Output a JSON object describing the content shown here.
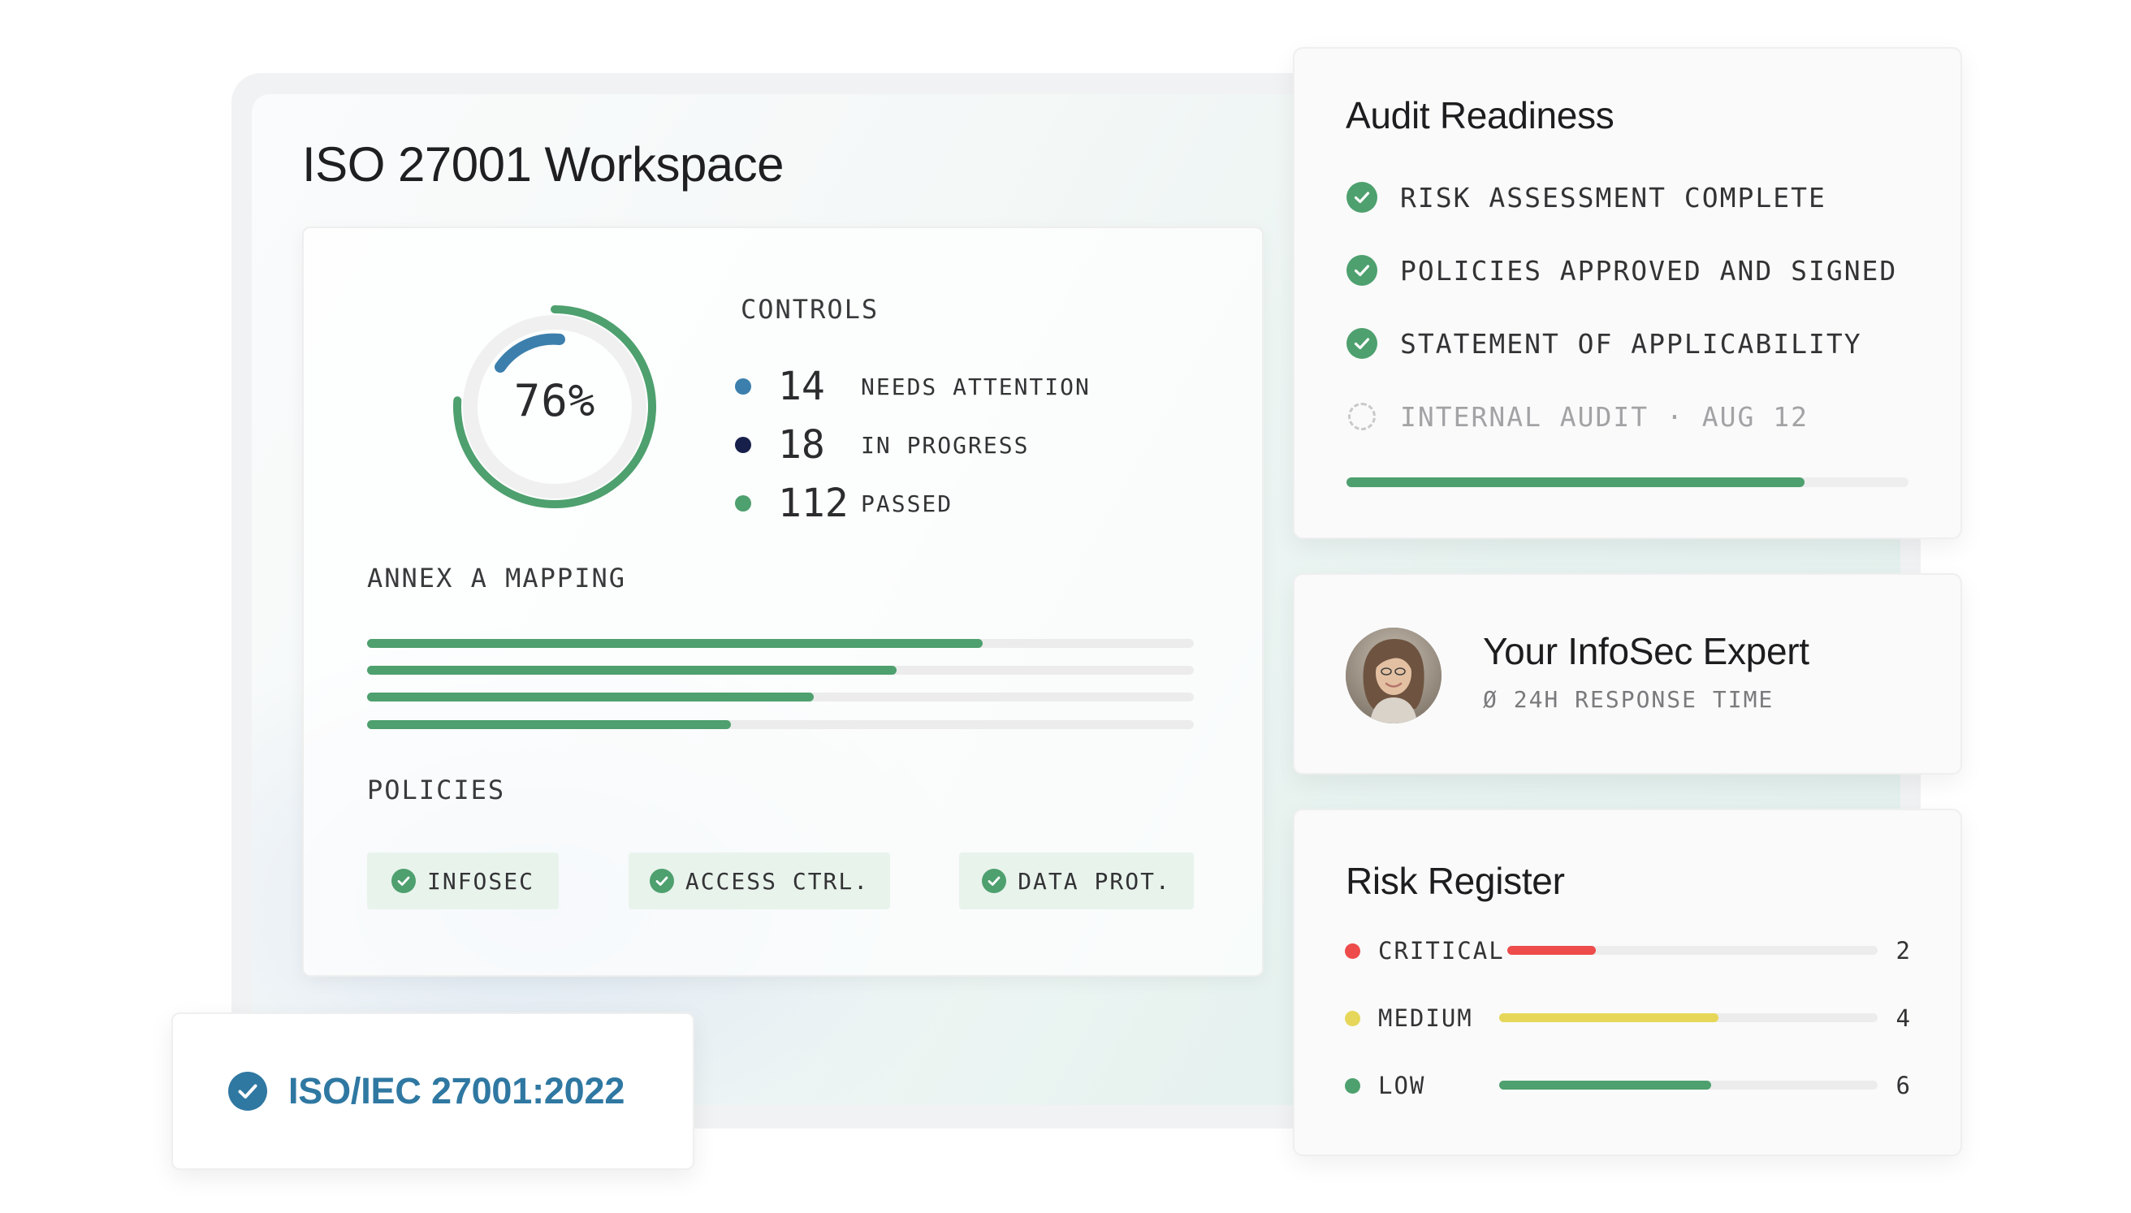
{
  "workspace": {
    "title": "ISO 27001 Workspace"
  },
  "controls": {
    "progress_label": "76%",
    "progress_value": 0.76,
    "heading": "CONTROLS",
    "legend": [
      {
        "count": "14",
        "label": "NEEDS ATTENTION",
        "color": "#3c7fad"
      },
      {
        "count": "18",
        "label": "IN PROGRESS",
        "color": "#16204a"
      },
      {
        "count": "112",
        "label": "PASSED",
        "color": "#4ea06e"
      }
    ]
  },
  "annex": {
    "heading": "ANNEX A MAPPING",
    "bars": [
      0.745,
      0.64,
      0.54,
      0.44
    ]
  },
  "policies": {
    "heading": "POLICIES",
    "chips": [
      "INFOSEC",
      "ACCESS CTRL.",
      "DATA PROT."
    ]
  },
  "audit": {
    "title": "Audit Readiness",
    "items": [
      {
        "label": "RISK ASSESSMENT COMPLETE",
        "done": true
      },
      {
        "label": "POLICIES APPROVED AND SIGNED",
        "done": true
      },
      {
        "label": "STATEMENT OF APPLICABILITY",
        "done": true
      },
      {
        "label": "INTERNAL AUDIT · AUG 12",
        "done": false
      }
    ],
    "progress": 0.815
  },
  "expert": {
    "title": "Your InfoSec Expert",
    "subtitle": "Ø 24H RESPONSE TIME"
  },
  "risk": {
    "title": "Risk Register",
    "items": [
      {
        "label": "CRITICAL",
        "count": "2",
        "fill": 0.24,
        "color": "#ee4b4b"
      },
      {
        "label": "MEDIUM",
        "count": "4",
        "fill": 0.58,
        "color": "#e6d75a"
      },
      {
        "label": "LOW",
        "count": "6",
        "fill": 0.56,
        "color": "#4ea06e"
      }
    ]
  },
  "certification": {
    "label": "ISO/IEC 27001:2022"
  },
  "colors": {
    "accent_green": "#4ea06e",
    "accent_blue": "#2f78a2",
    "donut_arc_blue": "#3c7fad",
    "track_gray": "#ececec"
  },
  "icons": {
    "check": "check-circle-icon",
    "pending": "dashed-circle-icon",
    "certified": "verified-check-icon"
  }
}
